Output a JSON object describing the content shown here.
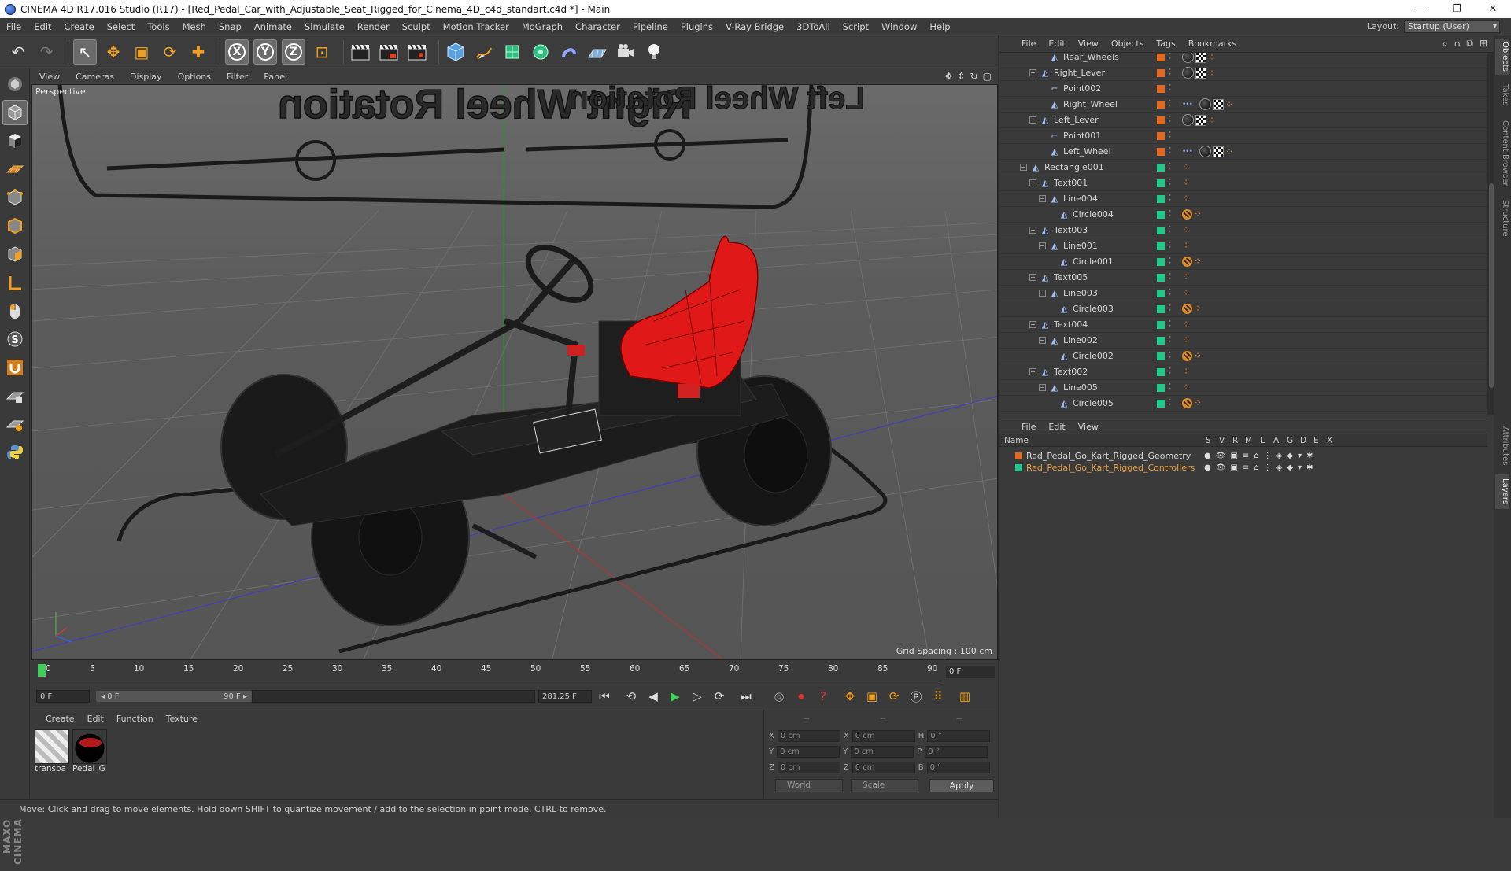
{
  "window": {
    "title": "CINEMA 4D R17.016 Studio (R17) - [Red_Pedal_Car_with_Adjustable_Seat_Rigged_for_Cinema_4D_c4d_standart.c4d *] - Main",
    "min": "—",
    "max": "❐",
    "close": "✕"
  },
  "menubar": {
    "items": [
      "File",
      "Edit",
      "Create",
      "Select",
      "Tools",
      "Mesh",
      "Snap",
      "Animate",
      "Simulate",
      "Render",
      "Sculpt",
      "Motion Tracker",
      "MoGraph",
      "Character",
      "Pipeline",
      "Plugins",
      "V-Ray Bridge",
      "3DToAll",
      "Script",
      "Window",
      "Help"
    ],
    "layout_label": "Layout:",
    "layout_value": "Startup (User)"
  },
  "toolbar": {
    "undo": "↶",
    "redo": "↷",
    "select": "↖",
    "move": "✥",
    "scale": "▣",
    "rotate": "⟳",
    "transform": "✚",
    "x": "X",
    "y": "Y",
    "z": "Z",
    "coord": "⊡"
  },
  "viewport": {
    "menu": [
      "View",
      "Cameras",
      "Display",
      "Options",
      "Filter",
      "Panel"
    ],
    "label": "Perspective",
    "grid_spacing": "Grid Spacing : 100 cm",
    "text_left": "Right Wheel Rotation",
    "text_right": "Left Wheel Rotation",
    "nav_icons": [
      "✥",
      "⇕",
      "↻",
      "▢"
    ]
  },
  "timeline": {
    "ticks": [
      "0",
      "5",
      "10",
      "15",
      "20",
      "25",
      "30",
      "35",
      "40",
      "45",
      "50",
      "55",
      "60",
      "65",
      "70",
      "75",
      "80",
      "85",
      "90"
    ],
    "frame_field": "0 F"
  },
  "playbar": {
    "start": "0 F",
    "range_start": "◂ 0 F",
    "range_end": "90 F ▸",
    "end": "281.25 F"
  },
  "materials": {
    "menu": [
      "Create",
      "Edit",
      "Function",
      "Texture"
    ],
    "items": [
      {
        "label": "transpa"
      },
      {
        "label": "Pedal_G"
      }
    ]
  },
  "coords": {
    "header": [
      "--",
      "--",
      "--"
    ],
    "rows": [
      {
        "a": "X",
        "av": "0 cm",
        "b": "X",
        "bv": "0 cm",
        "c": "H",
        "cv": "0 °"
      },
      {
        "a": "Y",
        "av": "0 cm",
        "b": "Y",
        "bv": "0 cm",
        "c": "P",
        "cv": "0 °"
      },
      {
        "a": "Z",
        "av": "0 cm",
        "b": "Z",
        "bv": "0 cm",
        "c": "B",
        "cv": "0 °"
      }
    ],
    "mode1": "World",
    "mode2": "Scale",
    "apply": "Apply"
  },
  "status": "Move: Click and drag to move elements. Hold down SHIFT to quantize movement / add to the selection in point mode, CTRL to remove.",
  "objects": {
    "menu": [
      "File",
      "Edit",
      "View",
      "Objects",
      "Tags",
      "Bookmarks"
    ],
    "rows": [
      {
        "name": "Rear_Wheels",
        "level": 3,
        "icon": "◭",
        "exp": "",
        "color": "#e06a20",
        "tags": [
          "dark",
          "check",
          "orange"
        ]
      },
      {
        "name": "Right_Lever",
        "level": 2,
        "icon": "◭",
        "exp": "−",
        "color": "#e06a20",
        "tags": [
          "dark",
          "check",
          "orange"
        ]
      },
      {
        "name": "Point002",
        "level": 3,
        "icon": "⌐",
        "exp": "",
        "color": "#e06a20",
        "tags": []
      },
      {
        "name": "Right_Wheel",
        "level": 3,
        "icon": "◭",
        "exp": "",
        "color": "#e06a20",
        "tags": [
          "dotsbl",
          "dark",
          "check",
          "orange"
        ]
      },
      {
        "name": "Left_Lever",
        "level": 2,
        "icon": "◭",
        "exp": "−",
        "color": "#e06a20",
        "tags": [
          "dark",
          "check",
          "orange"
        ]
      },
      {
        "name": "Point001",
        "level": 3,
        "icon": "⌐",
        "exp": "",
        "color": "#e06a20",
        "tags": []
      },
      {
        "name": "Left_Wheel",
        "level": 3,
        "icon": "◭",
        "exp": "",
        "color": "#e06a20",
        "tags": [
          "dotsbl",
          "dark",
          "check",
          "orange"
        ]
      },
      {
        "name": "Rectangle001",
        "level": 1,
        "icon": "◭",
        "exp": "−",
        "color": "#22c889",
        "tags": [
          "orange"
        ]
      },
      {
        "name": "Text001",
        "level": 2,
        "icon": "◭",
        "exp": "−",
        "color": "#22c889",
        "tags": [
          "orange"
        ]
      },
      {
        "name": "Line004",
        "level": 3,
        "icon": "◭",
        "exp": "−",
        "color": "#22c889",
        "tags": [
          "orange"
        ]
      },
      {
        "name": "Circle004",
        "level": 4,
        "icon": "◭",
        "exp": "",
        "color": "#22c889",
        "tags": [
          "forbid",
          "orange"
        ]
      },
      {
        "name": "Text003",
        "level": 2,
        "icon": "◭",
        "exp": "−",
        "color": "#22c889",
        "tags": [
          "orange"
        ]
      },
      {
        "name": "Line001",
        "level": 3,
        "icon": "◭",
        "exp": "−",
        "color": "#22c889",
        "tags": [
          "orange"
        ]
      },
      {
        "name": "Circle001",
        "level": 4,
        "icon": "◭",
        "exp": "",
        "color": "#22c889",
        "tags": [
          "forbid",
          "orange"
        ]
      },
      {
        "name": "Text005",
        "level": 2,
        "icon": "◭",
        "exp": "−",
        "color": "#22c889",
        "tags": [
          "orange"
        ]
      },
      {
        "name": "Line003",
        "level": 3,
        "icon": "◭",
        "exp": "−",
        "color": "#22c889",
        "tags": [
          "orange"
        ]
      },
      {
        "name": "Circle003",
        "level": 4,
        "icon": "◭",
        "exp": "",
        "color": "#22c889",
        "tags": [
          "forbid",
          "orange"
        ]
      },
      {
        "name": "Text004",
        "level": 2,
        "icon": "◭",
        "exp": "−",
        "color": "#22c889",
        "tags": [
          "orange"
        ]
      },
      {
        "name": "Line002",
        "level": 3,
        "icon": "◭",
        "exp": "−",
        "color": "#22c889",
        "tags": [
          "orange"
        ]
      },
      {
        "name": "Circle002",
        "level": 4,
        "icon": "◭",
        "exp": "",
        "color": "#22c889",
        "tags": [
          "forbid",
          "orange"
        ]
      },
      {
        "name": "Text002",
        "level": 2,
        "icon": "◭",
        "exp": "−",
        "color": "#22c889",
        "tags": [
          "orange"
        ]
      },
      {
        "name": "Line005",
        "level": 3,
        "icon": "◭",
        "exp": "−",
        "color": "#22c889",
        "tags": [
          "orange"
        ]
      },
      {
        "name": "Circle005",
        "level": 4,
        "icon": "◭",
        "exp": "",
        "color": "#22c889",
        "tags": [
          "forbid",
          "orange"
        ]
      }
    ]
  },
  "layers": {
    "menu": [
      "File",
      "Edit",
      "View"
    ],
    "headers": [
      "Name",
      "S",
      "V",
      "R",
      "M",
      "L",
      "A",
      "G",
      "D",
      "E",
      "X"
    ],
    "rows": [
      {
        "name": "Red_Pedal_Go_Kart_Rigged_Geometry",
        "color": "#e06a20",
        "text_color": "#d8d8d8"
      },
      {
        "name": "Red_Pedal_Go_Kart_Rigged_Controllers",
        "color": "#22c889",
        "text_color": "#e8a040"
      }
    ]
  },
  "sidetabs": [
    "Objects",
    "Takes",
    "Content Browser",
    "Structure",
    "Attributes",
    "Layers"
  ]
}
